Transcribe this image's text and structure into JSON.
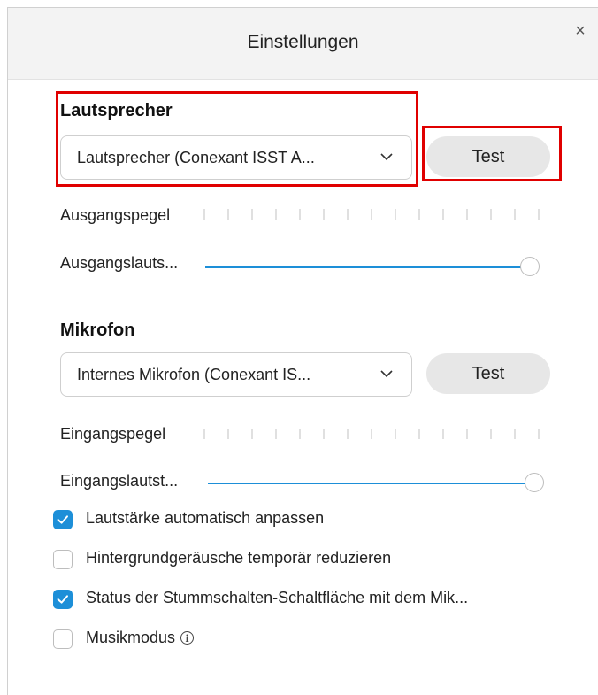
{
  "dialog": {
    "title": "Einstellungen",
    "close_symbol": "×"
  },
  "speaker": {
    "section_title": "Lautsprecher",
    "device": "Lautsprecher (Conexant ISST A...",
    "test_label": "Test",
    "level_label": "Ausgangspegel",
    "level_value": 0,
    "volume_label": "Ausgangslauts...",
    "volume_value": 1.0
  },
  "microphone": {
    "section_title": "Mikrofon",
    "device": "Internes Mikrofon (Conexant IS...",
    "test_label": "Test",
    "level_label": "Eingangspegel",
    "level_value": 0,
    "volume_label": "Eingangslautst...",
    "volume_value": 1.0
  },
  "options": [
    {
      "label": "Lautstärke automatisch anpassen",
      "checked": true
    },
    {
      "label": "Hintergrundgeräusche temporär reduzieren",
      "checked": false
    },
    {
      "label": "Status der Stummschalten-Schaltfläche mit dem Mik...",
      "checked": true
    },
    {
      "label": "Musikmodus",
      "checked": false
    }
  ],
  "icons": {
    "info": "i"
  },
  "colors": {
    "accent": "#1d8fd8",
    "highlight": "#e00000",
    "header_bg": "#f3f3f3",
    "button_bg": "#e7e7e7"
  }
}
